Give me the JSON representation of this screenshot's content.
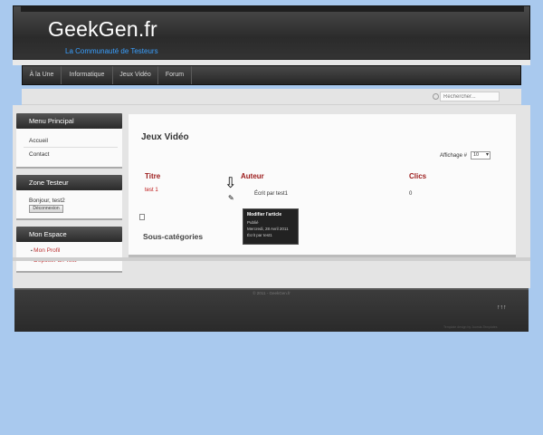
{
  "header": {
    "site_name": "GeekGen.fr",
    "tagline": "La Communauté de Testeurs"
  },
  "nav": {
    "items": [
      {
        "label": "À la Une"
      },
      {
        "label": "Informatique"
      },
      {
        "label": "Jeux Vidéo"
      },
      {
        "label": "Forum"
      }
    ]
  },
  "search": {
    "placeholder": "Rechercher..."
  },
  "sidebar": {
    "menu_title": "Menu Principal",
    "menu_items": [
      {
        "label": "Accueil"
      },
      {
        "label": "Contact"
      }
    ],
    "zone_title": "Zone Testeur",
    "greeting": "Bonjour, test2",
    "logout_label": "Déconnexion",
    "space_title": "Mon Espace",
    "space_items": [
      {
        "label": "Mon Profil"
      },
      {
        "label": "Déposer un Test"
      }
    ]
  },
  "main": {
    "title": "Jeux Vidéo",
    "display_label": "Affichage #",
    "display_value": "10",
    "table": {
      "headers": [
        "Titre",
        "Auteur",
        "Clics"
      ],
      "rows": [
        {
          "title": "test 1",
          "author": "Écrit par test1",
          "clicks": "0"
        }
      ]
    },
    "subcategories_title": "Sous-catégories"
  },
  "tooltip": {
    "title": "Modifier l'article",
    "status": "Publié",
    "date": "Mercredi, 28 Avril 2011",
    "author": "Écrit par test1"
  },
  "footer": {
    "copyright": "© 2011 - GeekGen.fr",
    "arrows": "↑↑↑",
    "credit": "Template design by Joomla-Templates"
  },
  "colors": {
    "background": "#a9c9ee",
    "header": "#2b2b2b",
    "tagline": "#3aa0ff",
    "column_head": "#9b1a1a",
    "link": "#b11111"
  }
}
